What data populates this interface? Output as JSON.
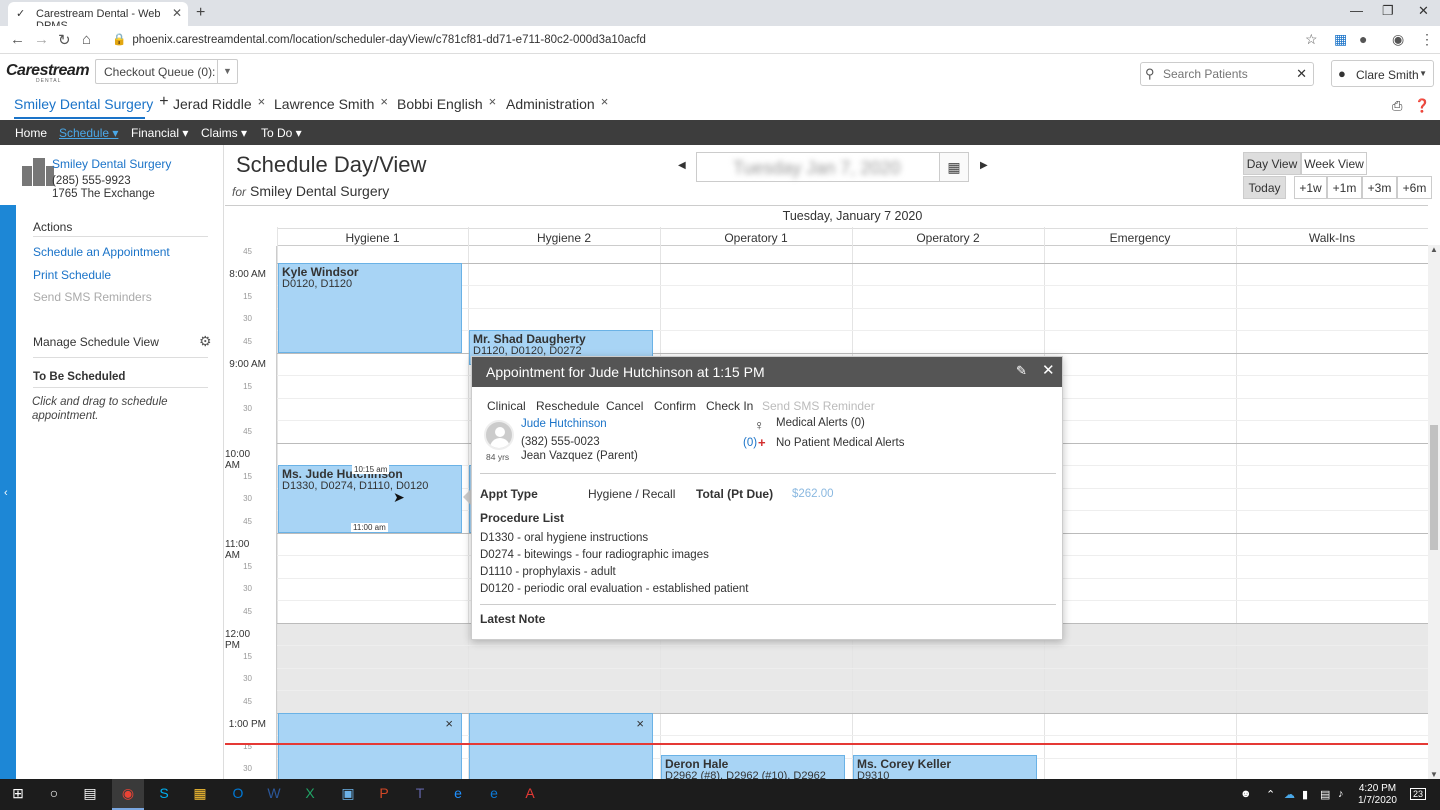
{
  "browser": {
    "tab_title": "Carestream Dental - Web DPMS",
    "url": "phoenix.carestreamdental.com/location/scheduler-dayView/c781cf81-dd71-e711-80c2-000d3a10acfd"
  },
  "header": {
    "logo": "Carestream",
    "logo_sub": "DENTAL",
    "checkout_queue": "Checkout Queue (0):",
    "search_placeholder": "Search Patients",
    "user": "Clare Smith"
  },
  "context_tabs": [
    {
      "label": "Smiley Dental Surgery",
      "close": "+"
    },
    {
      "label": "Jerad Riddle",
      "close": "×"
    },
    {
      "label": "Lawrence Smith",
      "close": "×"
    },
    {
      "label": "Bobbi English",
      "close": "×"
    },
    {
      "label": "Administration",
      "close": "×"
    }
  ],
  "nav": [
    "Home",
    "Schedule ▾",
    "Financial ▾",
    "Claims ▾",
    "To Do ▾"
  ],
  "sidebar": {
    "office_name": "Smiley Dental Surgery",
    "office_phone": "(285) 555-9923",
    "office_address": "1765 The Exchange",
    "actions_title": "Actions",
    "schedule_appt": "Schedule an Appointment",
    "print_schedule": "Print Schedule",
    "send_sms": "Send SMS Reminders",
    "manage_view": "Manage Schedule View",
    "to_be_scheduled": "To Be Scheduled",
    "hint": "Click and drag to schedule appointment."
  },
  "schedule": {
    "title": "Schedule Day/View",
    "for_label": "for",
    "for_value": "Smiley Dental Surgery",
    "date_value": "Tuesday Jan 7, 2020",
    "day_view": "Day View",
    "week_view": "Week View",
    "today": "Today",
    "r1w": "+1w",
    "r1m": "+1m",
    "r3m": "+3m",
    "r6m": "+6m",
    "grid_date": "Tuesday, January 7 2020",
    "columns": [
      "Hygiene 1",
      "Hygiene 2",
      "Operatory 1",
      "Operatory 2",
      "Emergency",
      "Walk-Ins"
    ],
    "times": {
      "t45a": "45",
      "t8": "8:00 AM",
      "t8_15": "15",
      "t8_30": "30",
      "t8_45": "45",
      "t9": "9:00 AM",
      "t9_15": "15",
      "t9_30": "30",
      "t9_45": "45",
      "t10": "10:00 AM",
      "t10_15": "15",
      "t10_30": "30",
      "t10_45": "45",
      "t11": "11:00 AM",
      "t11_15": "15",
      "t11_30": "30",
      "t11_45": "45",
      "t12": "12:00 PM",
      "t12_15": "15",
      "t12_30": "30",
      "t12_45": "45",
      "t13": "1:00 PM",
      "t13_15": "15",
      "t13_30": "30"
    },
    "appointments": {
      "kyle": {
        "name": "Kyle Windsor",
        "codes": "D0120, D1120"
      },
      "shad": {
        "name": "Mr. Shad Daugherty",
        "codes": "D1120, D0120, D0272"
      },
      "jude": {
        "name": "Ms. Jude Hutchinson",
        "codes": "D1330, D0274, D1110, D0120",
        "start_badge": "10:15 am",
        "end_badge": "11:00 am"
      },
      "deron": {
        "name": "Deron Hale",
        "codes": "D2962 (#8), D2962 (#10), D2962 (#9)"
      },
      "corey": {
        "name": "Ms. Corey Keller",
        "codes": "D9310"
      },
      "close": "×"
    }
  },
  "popover": {
    "title": "Appointment for Jude Hutchinson at 1:15 PM",
    "actions": [
      "Clinical",
      "Reschedule",
      "Cancel",
      "Confirm",
      "Check In",
      "Send SMS Reminder"
    ],
    "patient_name": "Jude Hutchinson",
    "phone": "(382) 555-0023",
    "guardian": "Jean Vazquez (Parent)",
    "age": "84 yrs",
    "medical_alerts": "Medical Alerts (0)",
    "med_count": "(0)",
    "no_alerts": "No Patient Medical Alerts",
    "appt_type_label": "Appt Type",
    "appt_type_value": "Hygiene / Recall",
    "total_label": "Total (Pt Due)",
    "total_value": "$262.00",
    "proc_list_label": "Procedure List",
    "procedures": [
      "D1330 - oral hygiene instructions",
      "D0274 - bitewings - four radiographic images",
      "D1110 - prophylaxis - adult",
      "D0120 - periodic oral evaluation - established patient"
    ],
    "latest_note_label": "Latest Note"
  },
  "taskbar": {
    "time": "4:20 PM",
    "date": "1/7/2020",
    "notif": "23"
  },
  "colors": {
    "accent": "#1a73c8",
    "appt_fill": "#a8d4f5",
    "nav_bg": "#3d3d3d",
    "current_time": "#e53935"
  }
}
